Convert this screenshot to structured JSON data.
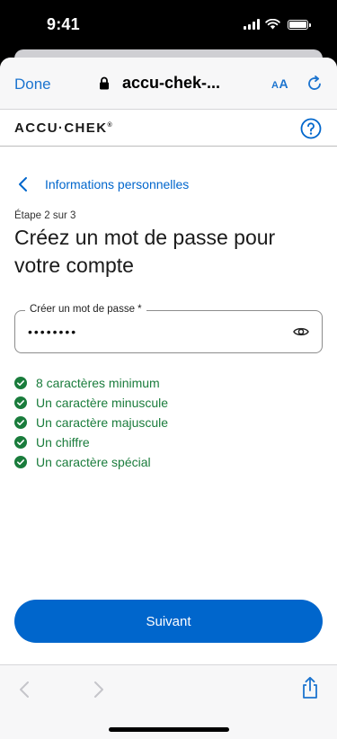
{
  "status_bar": {
    "time": "9:41"
  },
  "browser": {
    "done_label": "Done",
    "url": "accu-chek-...",
    "text_size_small": "A",
    "text_size_large": "A"
  },
  "site": {
    "logo": "ACCU·CHEK",
    "logo_mark": "®"
  },
  "page": {
    "back_label": "Informations personnelles",
    "step": "Étape 2 sur 3",
    "title": "Créez un mot de passe pour votre compte"
  },
  "password_field": {
    "label": "Créer un mot de passe *",
    "value": "••••••••"
  },
  "rules": [
    {
      "label": "8 caractères minimum",
      "met": true
    },
    {
      "label": "Un caractère minuscule",
      "met": true
    },
    {
      "label": "Un caractère majuscule",
      "met": true
    },
    {
      "label": "Un chiffre",
      "met": true
    },
    {
      "label": "Un caractère spécial",
      "met": true
    }
  ],
  "next_button": {
    "label": "Suivant"
  },
  "colors": {
    "primary": "#0066cc",
    "success": "#1a7c3c",
    "browser_accent": "#1c74cf"
  }
}
